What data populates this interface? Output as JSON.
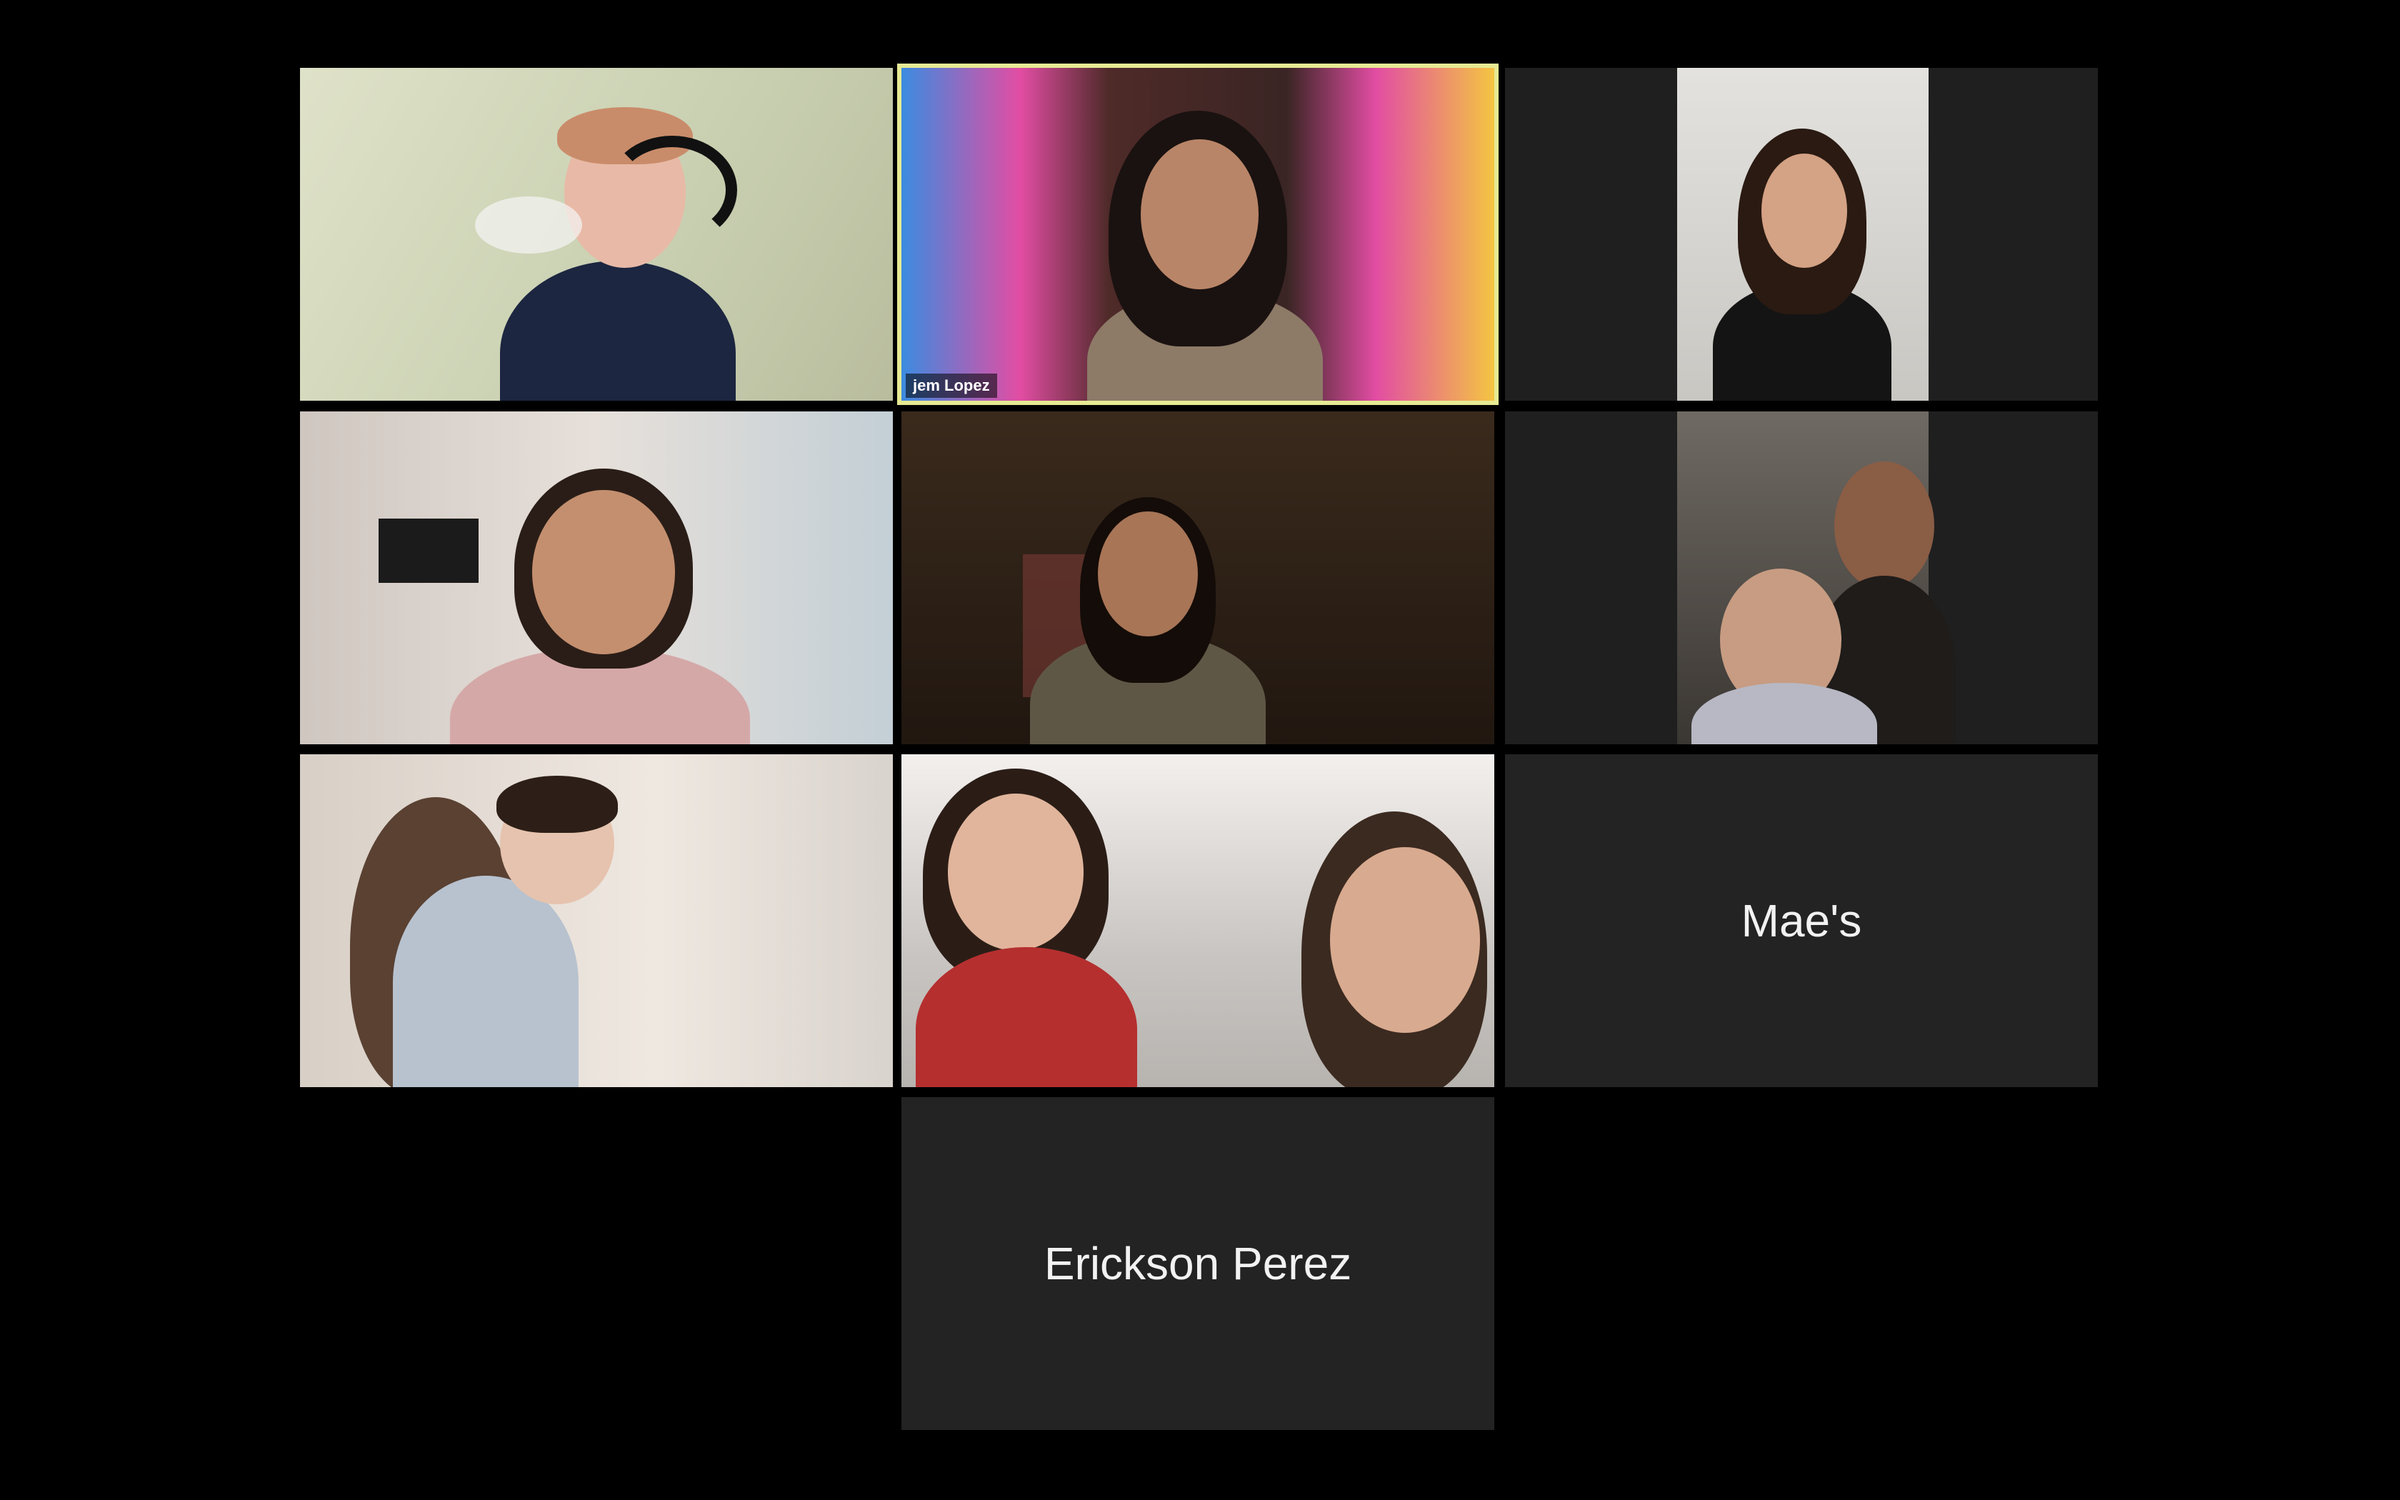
{
  "meeting": {
    "layout": "gallery",
    "active_speaker_color": "#e6ea93",
    "tiles": [
      {
        "video": true,
        "label": ""
      },
      {
        "video": true,
        "label": "jem Lopez",
        "active": true
      },
      {
        "video": true,
        "label": ""
      },
      {
        "video": true,
        "label": ""
      },
      {
        "video": true,
        "label": ""
      },
      {
        "video": true,
        "label": ""
      },
      {
        "video": true,
        "label": ""
      },
      {
        "video": true,
        "label": ""
      },
      {
        "video": false,
        "label": "Mae's"
      },
      {
        "video": false,
        "label": "Erickson Perez"
      }
    ]
  }
}
